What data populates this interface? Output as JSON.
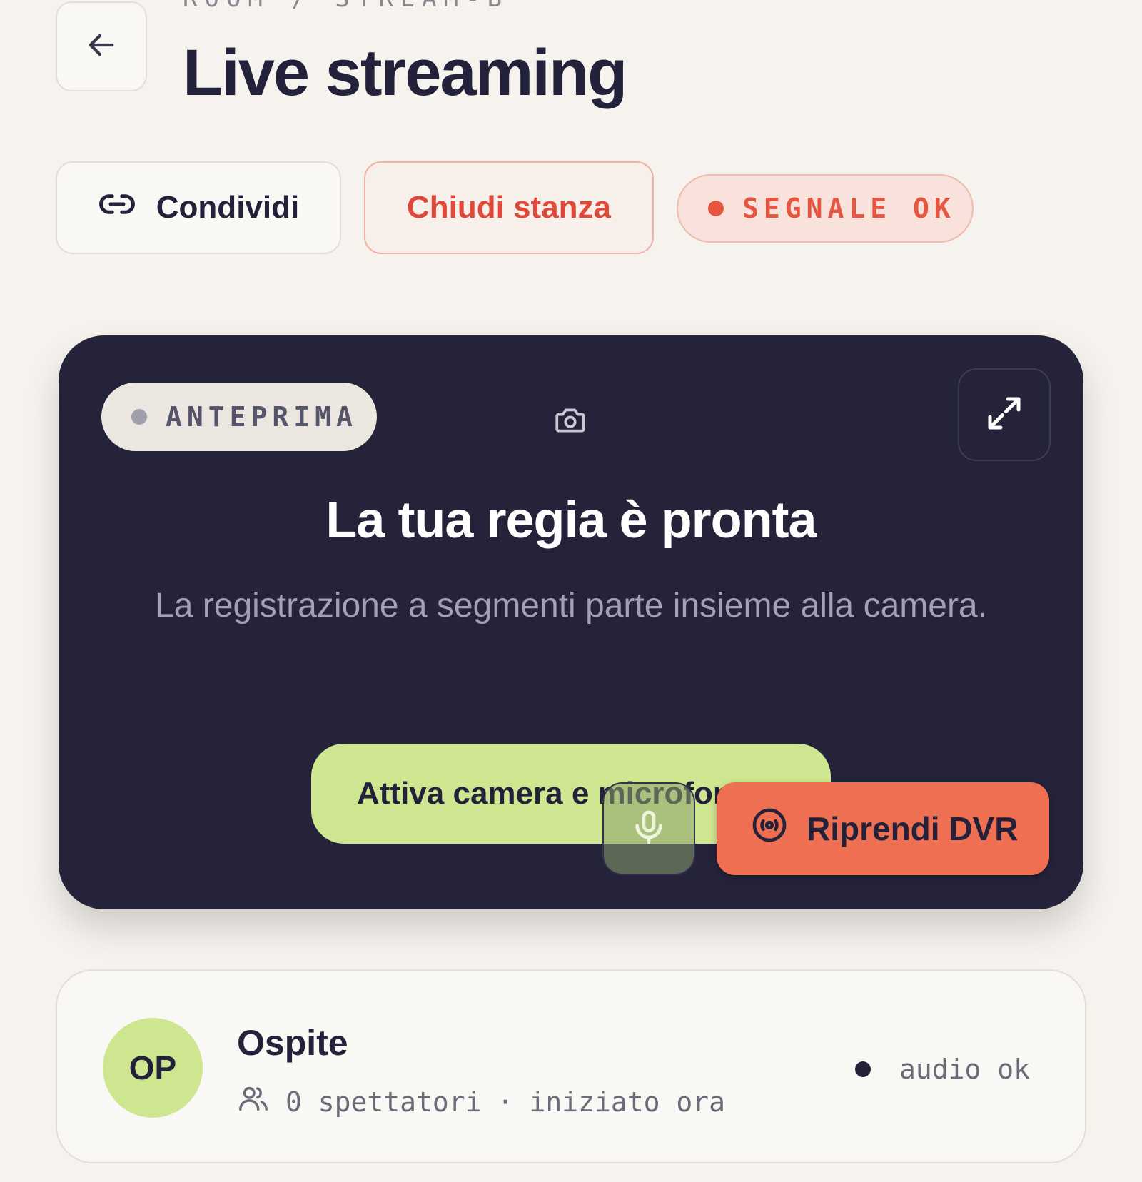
{
  "header": {
    "breadcrumb": "ROOM / STREAM-B",
    "title": "Live streaming"
  },
  "actions": {
    "share_label": "Condividi",
    "close_room_label": "Chiudi stanza",
    "signal_status": "SEGNALE OK"
  },
  "stage": {
    "preview_badge": "ANTEPRIMA",
    "title": "La tua regia è pronta",
    "subtitle": "La registrazione a segmenti parte insieme alla camera.",
    "activate_label": "Attiva camera e microfono",
    "dvr_label": "Riprendi DVR"
  },
  "participant": {
    "initials": "OP",
    "name": "Ospite",
    "viewers": "0 spettatori",
    "separator": "·",
    "started": "iniziato ora",
    "audio_status": "audio ok"
  },
  "icons": [
    "back-arrow-icon",
    "link-icon",
    "camera-icon",
    "expand-icon",
    "microphone-icon",
    "dvr-icon",
    "users-icon"
  ],
  "colors": {
    "background": "#f6f3ee",
    "stage": "#24233a",
    "accent_green": "#cfe690",
    "accent_orange": "#ee6f52",
    "danger": "#e0483a"
  }
}
